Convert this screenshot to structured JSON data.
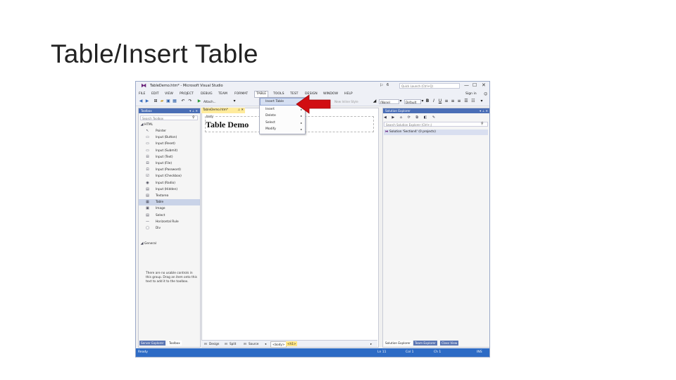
{
  "slide": {
    "title": "Table/Insert Table"
  },
  "window": {
    "title": "TableDemo.htm* - Microsoft Visual Studio",
    "quick_launch_placeholder": "Quick Launch (Ctrl+Q)",
    "filter_count": "6",
    "user": "Sign in",
    "controls": {
      "minimize": "—",
      "maximize": "☐",
      "close": "✕"
    }
  },
  "menu": {
    "items": [
      "FILE",
      "EDIT",
      "VIEW",
      "PROJECT",
      "DEBUG",
      "TEAM",
      "FORMAT",
      "TABLE",
      "TOOLS",
      "TEST",
      "DESIGN",
      "WINDOW",
      "HELP"
    ]
  },
  "toolbar": {
    "run_label": "Attach...",
    "style_select": "(None)",
    "font_select": "Default",
    "new_inline_style": "New Inline Style",
    "bold": "B",
    "italic": "I",
    "underline": "U"
  },
  "table_menu": {
    "items": [
      {
        "label": "Insert Table",
        "has_submenu": false
      },
      {
        "label": "Insert",
        "has_submenu": true
      },
      {
        "label": "Delete",
        "has_submenu": true
      },
      {
        "label": "Select",
        "has_submenu": true
      },
      {
        "label": "Modify",
        "has_submenu": true
      }
    ]
  },
  "toolbox": {
    "header": "Toolbox",
    "search_placeholder": "Search Toolbox",
    "group_html": "HTML",
    "items": [
      {
        "label": "Pointer",
        "icon": "pointer-icon",
        "glyph": "↖"
      },
      {
        "label": "Input (Button)",
        "icon": "button-icon",
        "glyph": "▭"
      },
      {
        "label": "Input (Reset)",
        "icon": "reset-icon",
        "glyph": "▭"
      },
      {
        "label": "Input (Submit)",
        "icon": "submit-icon",
        "glyph": "▭"
      },
      {
        "label": "Input (Text)",
        "icon": "textbox-icon",
        "glyph": "⊟"
      },
      {
        "label": "Input (File)",
        "icon": "file-icon",
        "glyph": "⊟"
      },
      {
        "label": "Input (Password)",
        "icon": "password-icon",
        "glyph": "⊡"
      },
      {
        "label": "Input (Checkbox)",
        "icon": "checkbox-icon",
        "glyph": "☑"
      },
      {
        "label": "Input (Radio)",
        "icon": "radio-icon",
        "glyph": "◉"
      },
      {
        "label": "Input (Hidden)",
        "icon": "hidden-icon",
        "glyph": "▤"
      },
      {
        "label": "Textarea",
        "icon": "textarea-icon",
        "glyph": "▤"
      },
      {
        "label": "Table",
        "icon": "table-icon",
        "glyph": "▦"
      },
      {
        "label": "Image",
        "icon": "image-icon",
        "glyph": "▣"
      },
      {
        "label": "Select",
        "icon": "select-icon",
        "glyph": "▤"
      },
      {
        "label": "Horizontal Rule",
        "icon": "rule-icon",
        "glyph": "—"
      },
      {
        "label": "Div",
        "icon": "div-icon",
        "glyph": "▢"
      }
    ],
    "group_general": "General",
    "general_message": "There are no usable controls in this group. Drag an item onto this text to add it to the toolbox."
  },
  "editor": {
    "tab_label": "TableDemo.htm*",
    "body_tag": "body",
    "heading": "Table Demo",
    "views": [
      "Design",
      "Split",
      "Source"
    ],
    "breadcrumb": [
      "<body>",
      "<h1>"
    ]
  },
  "solution_explorer": {
    "header": "Solution Explorer",
    "search_placeholder": "Search Solution Explorer (Ctrl+;)",
    "root": "Solution 'Section4' (0 projects)",
    "toolbar_glyphs": "◀ ▶ ⌂ ⟳ ⧉ ◧ ✎"
  },
  "left_tabs": [
    "Server Explorer",
    "Toolbox"
  ],
  "right_tabs": [
    "Solution Explorer",
    "Team Explorer",
    "Class View"
  ],
  "status": {
    "left": "Ready",
    "ln": "Ln 11",
    "col": "Col 1",
    "ch": "Ch 1",
    "mode": "INS"
  },
  "colors": {
    "accent": "#68217a",
    "status": "#2d6bc5",
    "arrow": "#d10d12"
  }
}
